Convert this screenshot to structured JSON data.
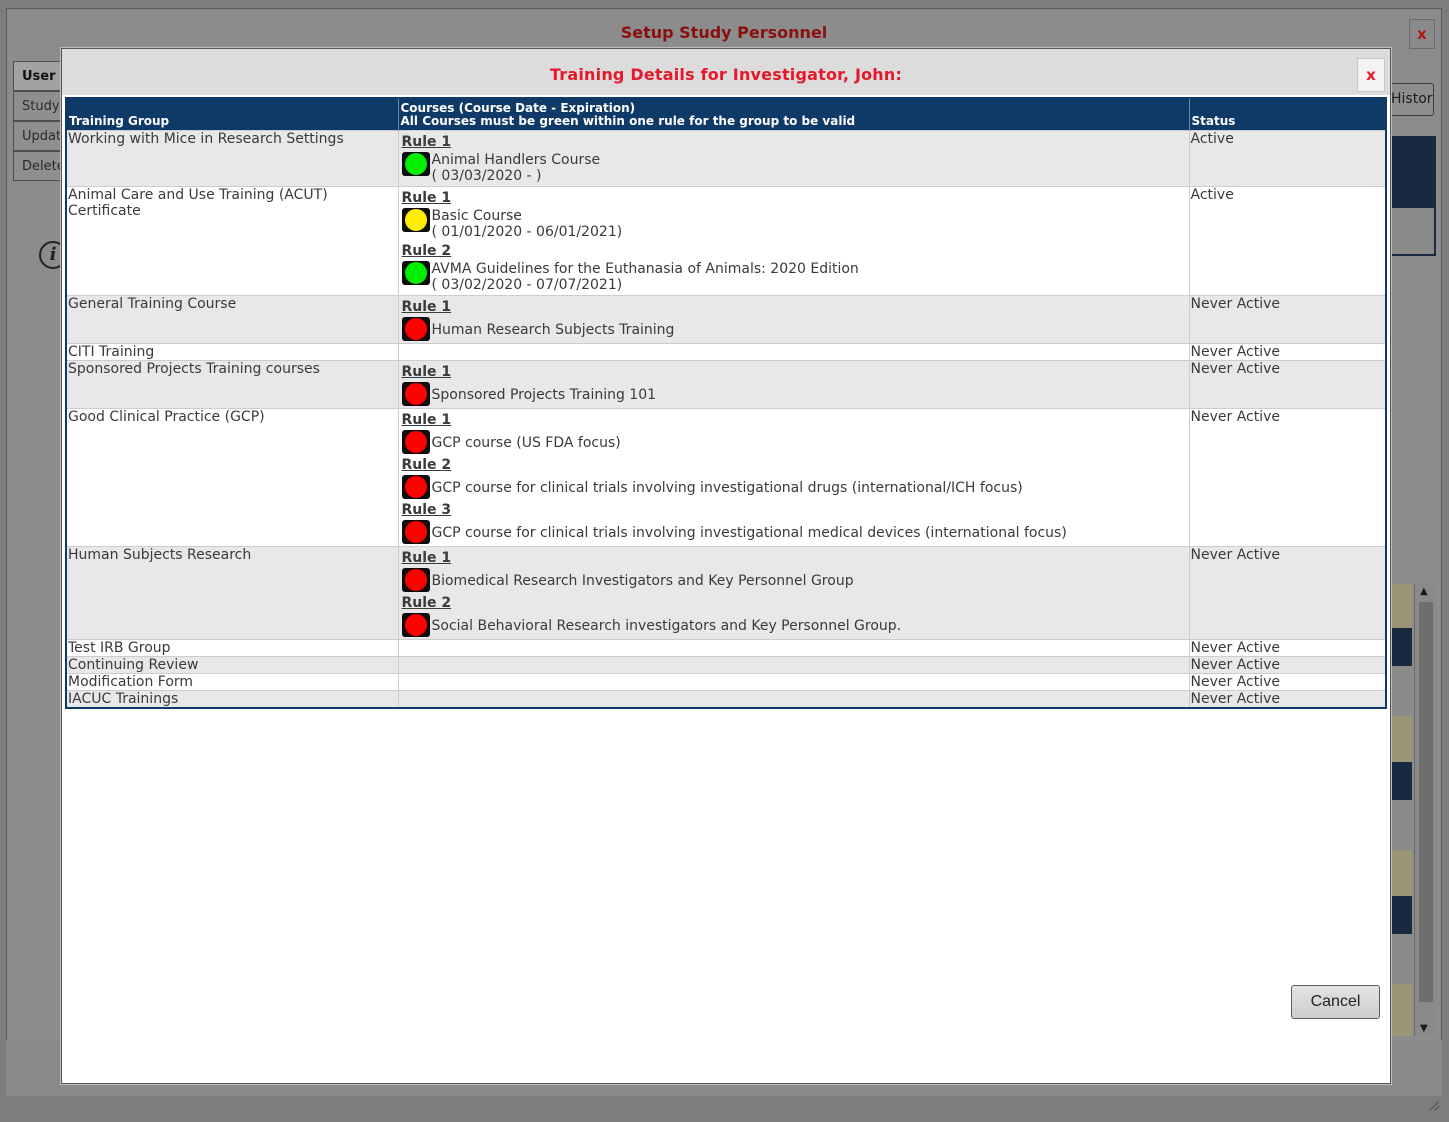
{
  "outer": {
    "title": "Setup Study Personnel",
    "close_label": "x",
    "tabs": [
      "User",
      "Study",
      "Update",
      "Delete"
    ],
    "history_button_label": "History"
  },
  "modal": {
    "title": "Training Details for Investigator, John:",
    "close_label": "x",
    "cancel_label": "Cancel"
  },
  "table": {
    "headers": {
      "group": "Training Group",
      "courses_line1": "Courses (Course Date - Expiration)",
      "courses_line2": "All Courses must be green within one rule for the group to be valid",
      "status": "Status"
    },
    "rows": [
      {
        "group": "Working with Mice in Research Settings",
        "status": "Active",
        "rules": [
          {
            "label": "Rule 1",
            "courses": [
              {
                "status_color": "#00ee00",
                "name": "Animal Handlers Course",
                "dates": "( 03/03/2020 - )"
              }
            ]
          }
        ]
      },
      {
        "group": "Animal Care and Use Training (ACUT) Certificate",
        "status": "Active",
        "rules": [
          {
            "label": "Rule 1",
            "courses": [
              {
                "status_color": "#ffee00",
                "name": "Basic Course",
                "dates": "( 01/01/2020 - 06/01/2021)"
              }
            ]
          },
          {
            "label": "Rule 2",
            "courses": [
              {
                "status_color": "#00ee00",
                "name": "AVMA Guidelines for the Euthanasia of Animals: 2020 Edition",
                "dates": "( 03/02/2020 - 07/07/2021)"
              }
            ]
          }
        ]
      },
      {
        "group": "General Training Course",
        "status": "Never Active",
        "rules": [
          {
            "label": "Rule 1",
            "courses": [
              {
                "status_color": "#ff0000",
                "name": "Human Research Subjects Training"
              }
            ]
          }
        ]
      },
      {
        "group": "CITI Training",
        "status": "Never Active",
        "rules": []
      },
      {
        "group": "Sponsored Projects Training courses",
        "status": "Never Active",
        "rules": [
          {
            "label": "Rule 1",
            "courses": [
              {
                "status_color": "#ff0000",
                "name": "Sponsored Projects Training 101"
              }
            ]
          }
        ]
      },
      {
        "group": "Good Clinical Practice (GCP)",
        "status": "Never Active",
        "rules": [
          {
            "label": "Rule 1",
            "courses": [
              {
                "status_color": "#ff0000",
                "name": "GCP course (US FDA focus)"
              }
            ]
          },
          {
            "label": "Rule 2",
            "courses": [
              {
                "status_color": "#ff0000",
                "name": "GCP course for clinical trials involving investigational drugs (international/ICH focus)"
              }
            ]
          },
          {
            "label": "Rule 3",
            "courses": [
              {
                "status_color": "#ff0000",
                "name": "GCP course for clinical trials involving investigational medical devices (international focus)"
              }
            ]
          }
        ]
      },
      {
        "group": "Human Subjects Research",
        "status": "Never Active",
        "rules": [
          {
            "label": "Rule 1",
            "courses": [
              {
                "status_color": "#ff0000",
                "name": "Biomedical Research Investigators and Key Personnel Group"
              }
            ]
          },
          {
            "label": "Rule 2",
            "courses": [
              {
                "status_color": "#ff0000",
                "name": "Social Behavioral Research investigators and Key Personnel Group."
              }
            ]
          }
        ]
      },
      {
        "group": "Test IRB Group",
        "status": "Never Active",
        "rules": []
      },
      {
        "group": "Continuing Review",
        "status": "Never Active",
        "rules": []
      },
      {
        "group": "Modification Form",
        "status": "Never Active",
        "rules": []
      },
      {
        "group": "IACUC Trainings",
        "status": "Never Active",
        "rules": []
      }
    ]
  }
}
